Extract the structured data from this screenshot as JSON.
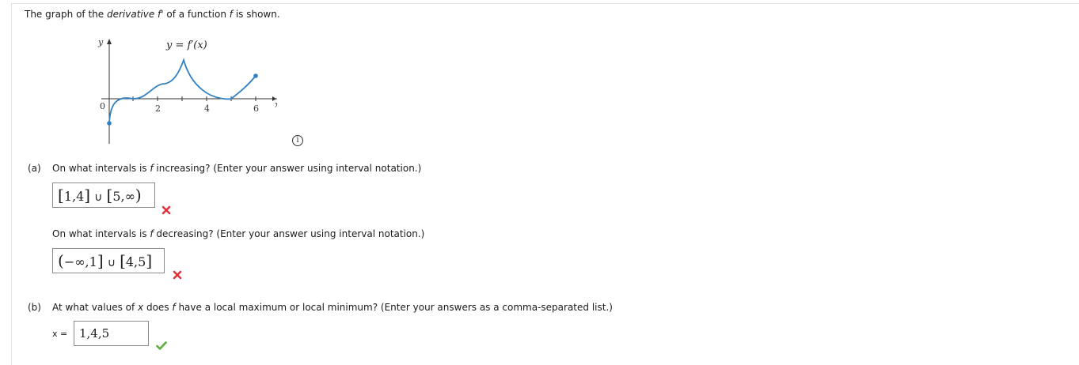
{
  "question": {
    "intro_pre": "The graph of the ",
    "intro_it": "derivative f'",
    "intro_mid": " of a function ",
    "intro_f": "f",
    "intro_post": " is shown."
  },
  "graph": {
    "curve_label": "y = f′(x)",
    "y_axis_label": "y",
    "x_axis_label": "x",
    "origin_label": "0",
    "tick_labels": [
      "2",
      "4",
      "6"
    ]
  },
  "part_a": {
    "label": "(a)",
    "q1_pre": "On what intervals is ",
    "q1_f": "f",
    "q1_post": " increasing? (Enter your answer using interval notation.)",
    "answer1": {
      "open": "[",
      "a": "1,4",
      "close": "]",
      "union": "∪",
      "open2": "[",
      "b": "5,∞",
      "close2": ")"
    },
    "answer1_status": "incorrect",
    "q2_pre": "On what intervals is ",
    "q2_f": "f",
    "q2_post": " decreasing? (Enter your answer using interval notation.)",
    "answer2": {
      "open": "(",
      "a": "−∞,1",
      "close": "]",
      "union": "∪",
      "open2": "[",
      "b": "4,5",
      "close2": "]"
    },
    "answer2_status": "incorrect"
  },
  "part_b": {
    "label": "(b)",
    "q_pre": "At what values of ",
    "q_x": "x",
    "q_mid": " does ",
    "q_f": "f",
    "q_post": " have a local maximum or local minimum? (Enter your answers as a comma-separated list.)",
    "input_label": "x =",
    "input_value": "1,4,5",
    "status": "correct"
  },
  "colors": {
    "curve": "#2f7fc1",
    "incorrect": "#e0323a",
    "correct": "#5cae3c"
  }
}
